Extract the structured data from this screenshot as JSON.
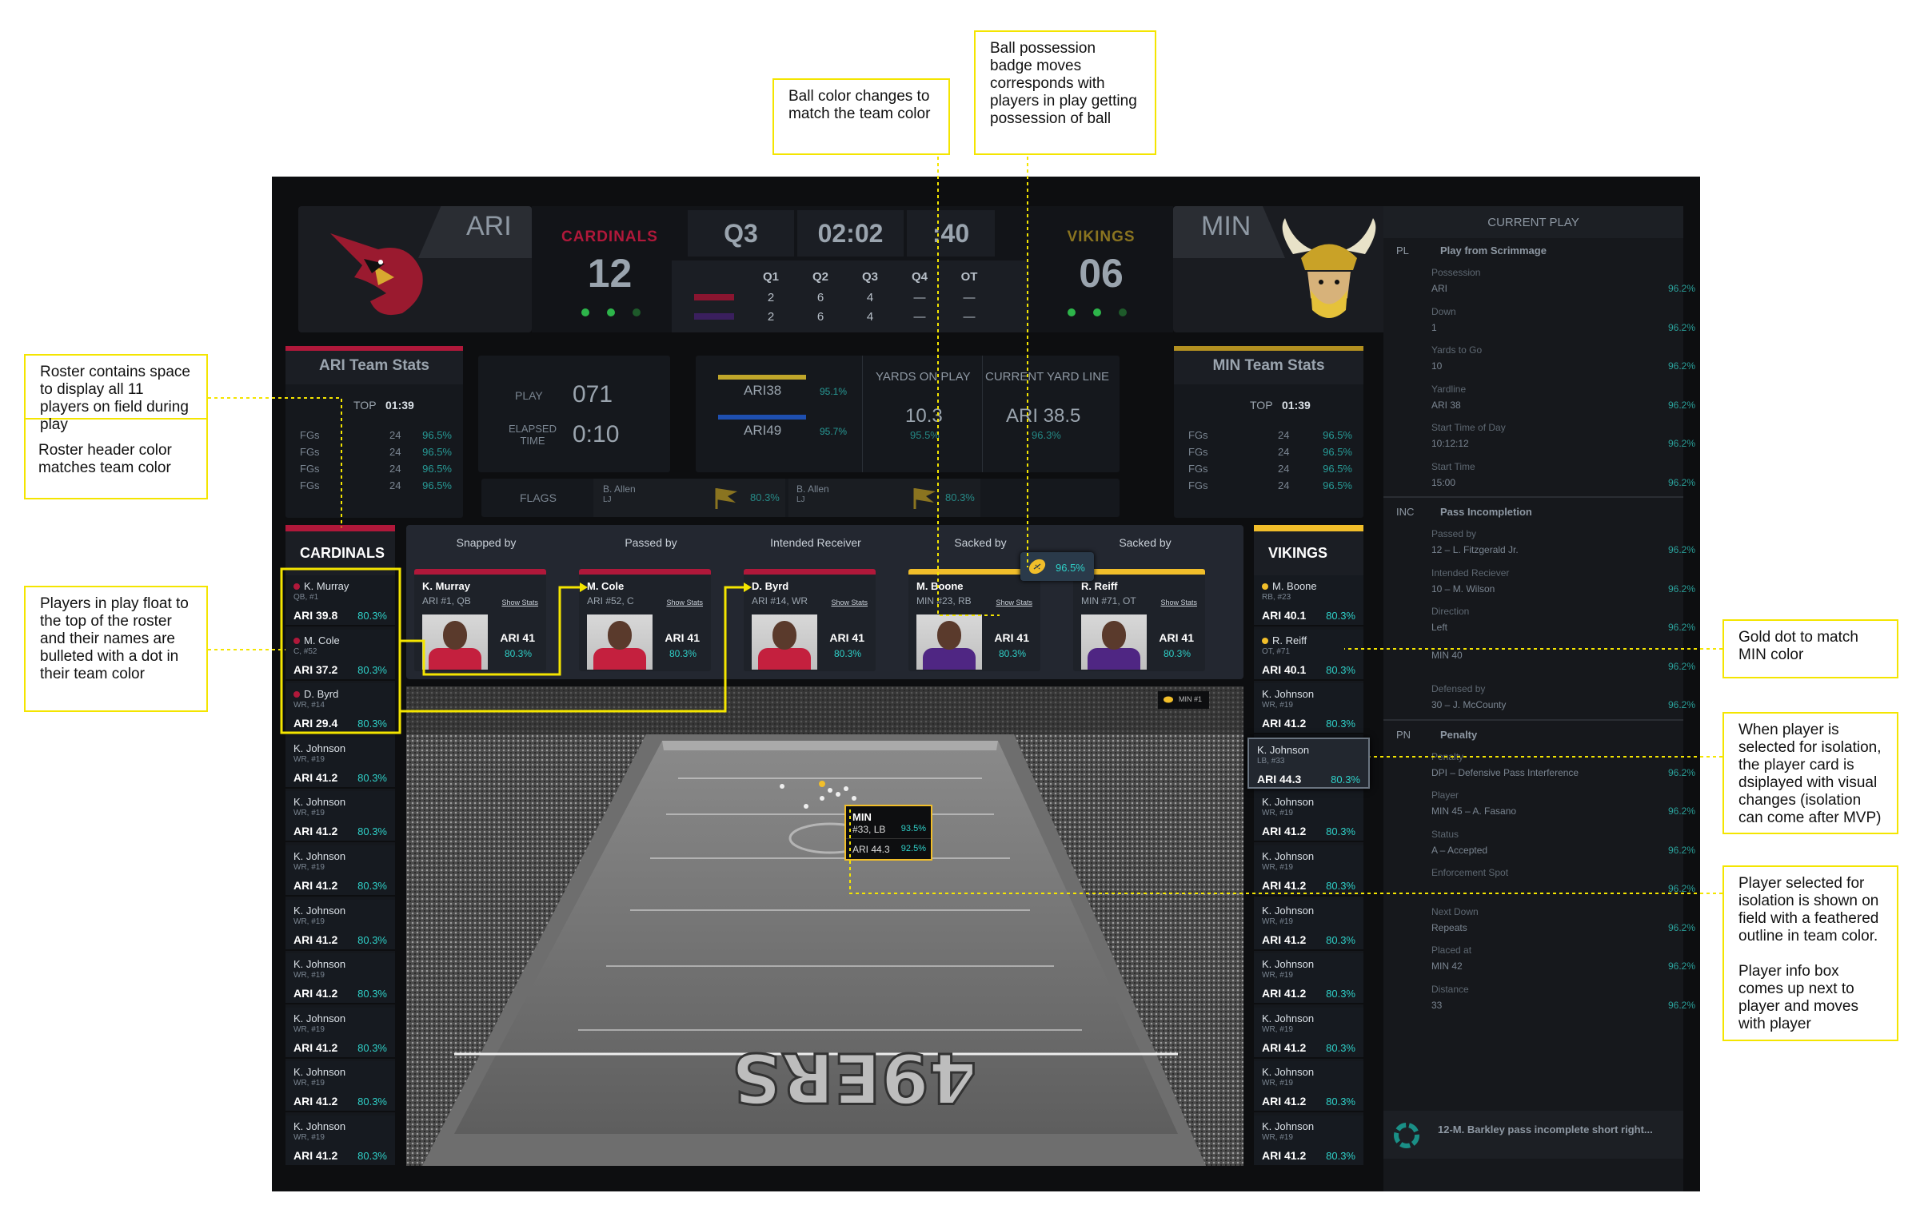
{
  "annotations": {
    "ball_color": "Ball color changes to match the team color",
    "possession_badge": "Ball possession badge moves corresponds with players in play getting possession of ball",
    "roster_space": "Roster contains space to display all 11 players on field during play",
    "roster_header": "Roster header color matches team color",
    "players_float": "Players in play float to the top of the roster and their names are bulleted with a dot in their team color",
    "gold_dot": "Gold dot to match MIN color",
    "isolation_card": "When player is selected for isolation, the player card is dsiplayed with visual changes (isolation can come after MVP)",
    "isolation_field": "Player selected for isolation is shown on field with a feathered outline in team color.",
    "info_box": "Player info box comes up next to player and moves with player"
  },
  "colors": {
    "ari": "#b0183a",
    "min": "#f1be2a",
    "min_purple": "#4f2683",
    "teal": "#2fd0c8",
    "annotation_border": "#f4e500"
  },
  "scoreboard": {
    "home": {
      "abbr": "ARI",
      "name": "CARDINALS",
      "score": "12"
    },
    "away": {
      "abbr": "MIN",
      "name": "VIKINGS",
      "score": "06"
    },
    "quarter": "Q3",
    "clock": "02:02",
    "play_clock": ":40",
    "quarter_headers": [
      "Q1",
      "Q2",
      "Q3",
      "Q4",
      "OT"
    ],
    "home_quarters": [
      "2",
      "6",
      "4",
      "—",
      "—"
    ],
    "away_quarters": [
      "2",
      "6",
      "4",
      "—",
      "—"
    ]
  },
  "team_stats": {
    "ari": {
      "title": "ARI Team Stats",
      "top_label": "TOP",
      "top_value": "01:39",
      "rows": [
        {
          "label": "FGs",
          "value": "24",
          "pct": "96.5%"
        },
        {
          "label": "FGs",
          "value": "24",
          "pct": "96.5%"
        },
        {
          "label": "FGs",
          "value": "24",
          "pct": "96.5%"
        },
        {
          "label": "FGs",
          "value": "24",
          "pct": "96.5%"
        }
      ]
    },
    "min": {
      "title": "MIN Team Stats",
      "top_label": "TOP",
      "top_value": "01:39",
      "rows": [
        {
          "label": "FGs",
          "value": "24",
          "pct": "96.5%"
        },
        {
          "label": "FGs",
          "value": "24",
          "pct": "96.5%"
        },
        {
          "label": "FGs",
          "value": "24",
          "pct": "96.5%"
        },
        {
          "label": "FGs",
          "value": "24",
          "pct": "96.5%"
        }
      ]
    }
  },
  "center": {
    "play_label": "PLAY",
    "play_value": "071",
    "elapsed_label": "ELAPSED TIME",
    "elapsed_value": "0:10",
    "yard_markers": [
      {
        "label": "ARI38",
        "pct": "95.1%"
      },
      {
        "label": "ARI49",
        "pct": "95.7%"
      }
    ],
    "yards_on_play_label": "YARDS ON PLAY",
    "yards_on_play_value": "10.3",
    "yards_on_play_pct": "95.5%",
    "current_yard_label": "CURRENT YARD LINE",
    "current_yard_value": "ARI 38.5",
    "current_yard_pct": "96.3%",
    "flags_label": "FLAGS",
    "flags": [
      {
        "name": "B. Allen",
        "sub": "LJ",
        "pct": "80.3%"
      },
      {
        "name": "B. Allen",
        "sub": "LJ",
        "pct": "80.3%"
      }
    ]
  },
  "roster_home": {
    "header": "CARDINALS",
    "players": [
      {
        "name": "K. Murray",
        "role": "QB, #1",
        "yard": "ARI 39.8",
        "pct": "80.3%",
        "bullet": true
      },
      {
        "name": "M. Cole",
        "role": "C, #52",
        "yard": "ARI 37.2",
        "pct": "80.3%",
        "bullet": true
      },
      {
        "name": "D. Byrd",
        "role": "WR, #14",
        "yard": "ARI 29.4",
        "pct": "80.3%",
        "bullet": true
      },
      {
        "name": "K. Johnson",
        "role": "WR, #19",
        "yard": "ARI 41.2",
        "pct": "80.3%"
      },
      {
        "name": "K. Johnson",
        "role": "WR, #19",
        "yard": "ARI 41.2",
        "pct": "80.3%"
      },
      {
        "name": "K. Johnson",
        "role": "WR, #19",
        "yard": "ARI 41.2",
        "pct": "80.3%"
      },
      {
        "name": "K. Johnson",
        "role": "WR, #19",
        "yard": "ARI 41.2",
        "pct": "80.3%"
      },
      {
        "name": "K. Johnson",
        "role": "WR, #19",
        "yard": "ARI 41.2",
        "pct": "80.3%"
      },
      {
        "name": "K. Johnson",
        "role": "WR, #19",
        "yard": "ARI 41.2",
        "pct": "80.3%"
      },
      {
        "name": "K. Johnson",
        "role": "WR, #19",
        "yard": "ARI 41.2",
        "pct": "80.3%"
      },
      {
        "name": "K. Johnson",
        "role": "WR, #19",
        "yard": "ARI 41.2",
        "pct": "80.3%"
      }
    ]
  },
  "roster_away": {
    "header": "VIKINGS",
    "players": [
      {
        "name": "M. Boone",
        "role": "RB, #23",
        "yard": "ARI 40.1",
        "pct": "80.3%",
        "bullet": true
      },
      {
        "name": "R. Reiff",
        "role": "OT, #71",
        "yard": "ARI 40.1",
        "pct": "80.3%",
        "bullet": true
      },
      {
        "name": "K. Johnson",
        "role": "WR, #19",
        "yard": "ARI 41.2",
        "pct": "80.3%"
      },
      {
        "name": "K. Johnson",
        "role": "LB, #33",
        "yard": "ARI 44.3",
        "pct": "80.3%",
        "selected": true
      },
      {
        "name": "K. Johnson",
        "role": "WR, #19",
        "yard": "ARI 41.2",
        "pct": "80.3%"
      },
      {
        "name": "K. Johnson",
        "role": "WR, #19",
        "yard": "ARI 41.2",
        "pct": "80.3%"
      },
      {
        "name": "K. Johnson",
        "role": "WR, #19",
        "yard": "ARI 41.2",
        "pct": "80.3%"
      },
      {
        "name": "K. Johnson",
        "role": "WR, #19",
        "yard": "ARI 41.2",
        "pct": "80.3%"
      },
      {
        "name": "K. Johnson",
        "role": "WR, #19",
        "yard": "ARI 41.2",
        "pct": "80.3%"
      },
      {
        "name": "K. Johnson",
        "role": "WR, #19",
        "yard": "ARI 41.2",
        "pct": "80.3%"
      },
      {
        "name": "K. Johnson",
        "role": "WR, #19",
        "yard": "ARI 41.2",
        "pct": "80.3%"
      }
    ]
  },
  "play_cards": {
    "headers": [
      "Snapped by",
      "Passed by",
      "Intended Receiver",
      "Sacked by",
      "Sacked by"
    ],
    "cards": [
      {
        "name": "K. Murray",
        "role": "ARI #1, QB",
        "show_stats": "Show Stats",
        "yard": "ARI 41",
        "pct": "80.3%",
        "team": "ari"
      },
      {
        "name": "M. Cole",
        "role": "ARI #52, C",
        "show_stats": "Show Stats",
        "yard": "ARI 41",
        "pct": "80.3%",
        "team": "ari"
      },
      {
        "name": "D. Byrd",
        "role": "ARI #14, WR",
        "show_stats": "Show Stats",
        "yard": "ARI 41",
        "pct": "80.3%",
        "team": "ari"
      },
      {
        "name": "M. Boone",
        "role": "MIN #23, RB",
        "show_stats": "Show Stats",
        "yard": "ARI 41",
        "pct": "80.3%",
        "team": "min"
      },
      {
        "name": "R. Reiff",
        "role": "MIN #71, OT",
        "show_stats": "Show Stats",
        "yard": "ARI 41",
        "pct": "80.3%",
        "team": "min"
      }
    ],
    "badge_pct": "96.5%"
  },
  "field": {
    "badge": "MIN #1",
    "endzone_text": "49ERS",
    "info_box": {
      "team": "MIN",
      "player": "#33, LB",
      "pct1": "93.5%",
      "yard": "ARI 44.3",
      "pct2": "92.5%"
    }
  },
  "current_play": {
    "title": "CURRENT PLAY",
    "sections": [
      {
        "code": "PL",
        "title": "Play from Scrimmage",
        "rows": [
          {
            "label": "Possession",
            "value": "ARI",
            "pct": "96.2%"
          },
          {
            "label": "Down",
            "value": "1",
            "pct": "96.2%"
          },
          {
            "label": "Yards to Go",
            "value": "10",
            "pct": "96.2%"
          },
          {
            "label": "Yardline",
            "value": "ARI 38",
            "pct": "96.2%"
          },
          {
            "label": "Start Time of Day",
            "value": "10:12:12",
            "pct": "96.2%"
          },
          {
            "label": "Start Time",
            "value": "15:00",
            "pct": "96.2%"
          }
        ]
      },
      {
        "code": "INC",
        "title": "Pass Incompletion",
        "rows": [
          {
            "label": "Passed by",
            "value": "12 – L. Fitzgerald Jr.",
            "pct": "96.2%"
          },
          {
            "label": "Intended Reciever",
            "value": "10 – M. Wilson",
            "pct": "96.2%"
          },
          {
            "label": "Direction",
            "value": "Left",
            "pct": "96.2%"
          },
          {
            "label": "",
            "value": "MIN 40",
            "pct": "96.2%"
          },
          {
            "label": "Defensed by",
            "value": "30 – J. McCounty",
            "pct": "96.2%"
          }
        ]
      },
      {
        "code": "PN",
        "title": "Penalty",
        "rows": [
          {
            "label": "Penalty",
            "value": "DPI – Defensive Pass Interference",
            "pct": "96.2%"
          },
          {
            "label": "Player",
            "value": "MIN 45 – A. Fasano",
            "pct": "96.2%"
          },
          {
            "label": "Status",
            "value": "A – Accepted",
            "pct": "96.2%"
          },
          {
            "label": "Enforcement Spot",
            "value": "",
            "pct": "96.2%"
          },
          {
            "label": "Next Down",
            "value": "Repeats",
            "pct": "96.2%"
          },
          {
            "label": "Placed at",
            "value": "MIN 42",
            "pct": "96.2%"
          },
          {
            "label": "Distance",
            "value": "33",
            "pct": "96.2%"
          }
        ]
      }
    ],
    "footer": "12-M. Barkley pass incomplete short right..."
  }
}
